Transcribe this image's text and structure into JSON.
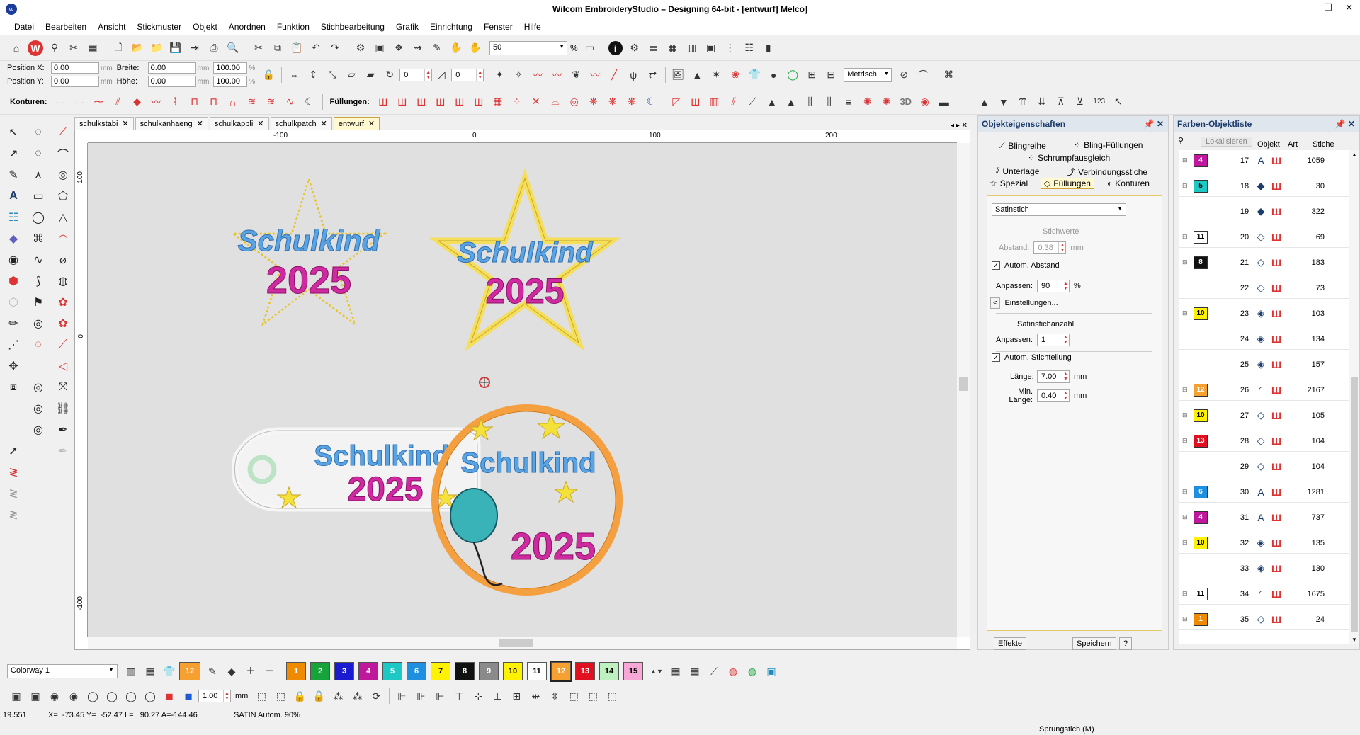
{
  "window": {
    "title": "Wilcom EmbroideryStudio – Designing 64-bit - [entwurf]        Melco]"
  },
  "menu": [
    "Datei",
    "Bearbeiten",
    "Ansicht",
    "Stickmuster",
    "Objekt",
    "Anordnen",
    "Funktion",
    "Stichbearbeitung",
    "Grafik",
    "Einrichtung",
    "Fenster",
    "Hilfe"
  ],
  "toolbar": {
    "zoom": "50",
    "zoom_unit": "%",
    "units": "Metrisch"
  },
  "position": {
    "x_label": "Position X:",
    "y_label": "Position Y:",
    "x": "0.00",
    "y": "0.00",
    "w_label": "Breite:",
    "h_label": "Höhe:",
    "w": "0.00",
    "h": "0.00",
    "pw": "100.00",
    "ph": "100.00",
    "unit_mm": "mm",
    "unit_pct": "%"
  },
  "row3": {
    "konturen": "Konturen:",
    "fuellungen": "Füllungen:",
    "label_3d": "3D",
    "label_123": "123"
  },
  "doc_tabs": [
    "schulkstabi",
    "schulkanhaeng",
    "schulkappli",
    "schulkpatch",
    "entwurf"
  ],
  "ruler": {
    "h": [
      "-100",
      "0",
      "100",
      "200"
    ],
    "v": [
      "100",
      "0",
      "-100"
    ]
  },
  "design": {
    "text1": "Schulkind",
    "year": "2025"
  },
  "props": {
    "header": "Objekteigenschaften",
    "tabs": [
      "Blingreihe",
      "Bling-Füllungen",
      "Schrumpfausgleich",
      "Unterlage",
      "Verbindungsstiche",
      "Spezial",
      "Füllungen",
      "Konturen"
    ],
    "fill_type": "Satinstich",
    "stichwerte": "Stichwerte",
    "abstand_label": "Abstand:",
    "abstand": "0.38",
    "mm": "mm",
    "autom_abstand": "Autom. Abstand",
    "anpassen_label": "Anpassen:",
    "anpassen": "90",
    "pct": "%",
    "einstellungen": "Einstellungen...",
    "satinstichanzahl": "Satinstichanzahl",
    "anpassen2": "1",
    "autom_stichteilung": "Autom. Stichteilung",
    "laenge_label": "Länge:",
    "laenge": "7.00",
    "minlaenge_label": "Min. Länge:",
    "minlaenge": "0.40",
    "effekte": "Effekte",
    "speichern": "Speichern",
    "help": "?"
  },
  "colorlist": {
    "header": "Farben-Objektliste",
    "lokalisieren": "Lokalisieren",
    "cols": [
      "Objekt",
      "Art",
      "Stiche"
    ],
    "rows": [
      {
        "sw": "4",
        "swc": "#c0189c",
        "n": "17",
        "obj": "A",
        "st": "1059"
      },
      {
        "sw": "5",
        "swc": "#1ec9c5",
        "n": "18",
        "obj": "◆",
        "st": "30"
      },
      {
        "sw": "",
        "swc": "",
        "n": "19",
        "obj": "◆",
        "st": "322"
      },
      {
        "sw": "11",
        "swc": "#ffffff",
        "n": "20",
        "obj": "◇",
        "st": "69"
      },
      {
        "sw": "8",
        "swc": "#111111",
        "n": "21",
        "obj": "◇",
        "st": "183"
      },
      {
        "sw": "",
        "swc": "",
        "n": "22",
        "obj": "◇",
        "st": "73"
      },
      {
        "sw": "10",
        "swc": "#fff200",
        "n": "23",
        "obj": "◈",
        "st": "103"
      },
      {
        "sw": "",
        "swc": "",
        "n": "24",
        "obj": "◈",
        "st": "134"
      },
      {
        "sw": "",
        "swc": "",
        "n": "25",
        "obj": "◈",
        "st": "157"
      },
      {
        "sw": "12",
        "swc": "#f5a030",
        "n": "26",
        "obj": "◜",
        "st": "2167"
      },
      {
        "sw": "10",
        "swc": "#fff200",
        "n": "27",
        "obj": "◇",
        "st": "105"
      },
      {
        "sw": "13",
        "swc": "#e01020",
        "n": "28",
        "obj": "◇",
        "st": "104"
      },
      {
        "sw": "",
        "swc": "",
        "n": "29",
        "obj": "◇",
        "st": "104"
      },
      {
        "sw": "6",
        "swc": "#1f8fe0",
        "n": "30",
        "obj": "A",
        "st": "1281"
      },
      {
        "sw": "4",
        "swc": "#c0189c",
        "n": "31",
        "obj": "A",
        "st": "737"
      },
      {
        "sw": "10",
        "swc": "#fff200",
        "n": "32",
        "obj": "◈",
        "st": "135"
      },
      {
        "sw": "",
        "swc": "",
        "n": "33",
        "obj": "◈",
        "st": "130"
      },
      {
        "sw": "11",
        "swc": "#ffffff",
        "n": "34",
        "obj": "◜",
        "st": "1675"
      },
      {
        "sw": "1",
        "swc": "#f08a00",
        "n": "35",
        "obj": "◇",
        "st": "24"
      }
    ]
  },
  "bottom": {
    "colorway": "Colorway 1",
    "current": "12",
    "swatches": [
      {
        "n": "1",
        "c": "#f08a00"
      },
      {
        "n": "2",
        "c": "#16a33a"
      },
      {
        "n": "3",
        "c": "#1a1ad0"
      },
      {
        "n": "4",
        "c": "#c0189c"
      },
      {
        "n": "5",
        "c": "#1ec9c5"
      },
      {
        "n": "6",
        "c": "#1f8fe0"
      },
      {
        "n": "7",
        "c": "#fff200"
      },
      {
        "n": "8",
        "c": "#111111"
      },
      {
        "n": "9",
        "c": "#8a8a8a"
      },
      {
        "n": "10",
        "c": "#fff200"
      },
      {
        "n": "11",
        "c": "#ffffff"
      },
      {
        "n": "12",
        "c": "#f5a030"
      },
      {
        "n": "13",
        "c": "#e01020"
      },
      {
        "n": "14",
        "c": "#bff0c0"
      },
      {
        "n": "15",
        "c": "#f7a8d6"
      }
    ],
    "width_val": "1.00",
    "width_unit": "mm"
  },
  "status": {
    "left": "19.551",
    "coords": "X=  -73.45 Y=  -52.47 L=   90.27 A=-144.46",
    "mode": "SATIN Autom. 90%",
    "right": "Sprungstich (M)"
  }
}
